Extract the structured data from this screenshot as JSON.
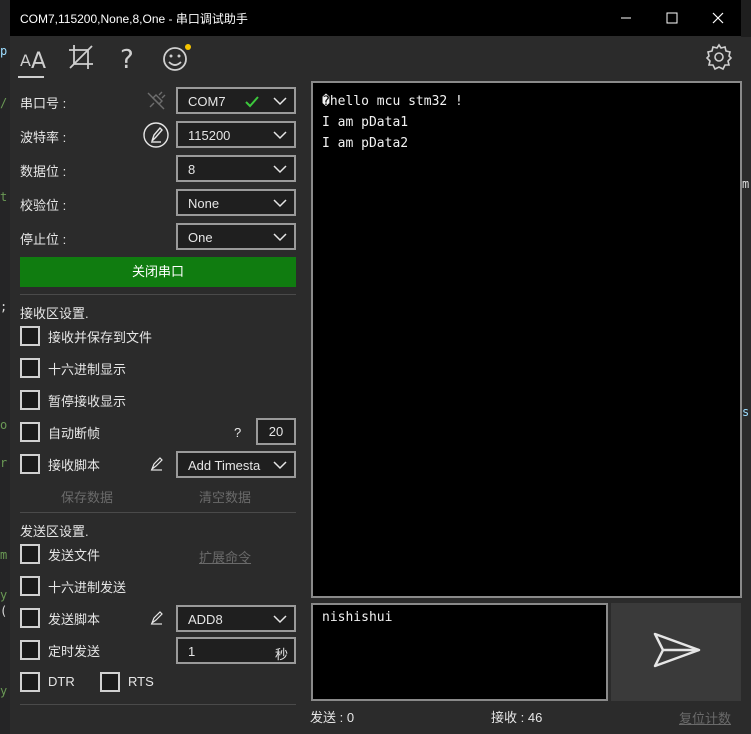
{
  "window": {
    "title": "COM7,115200,None,8,One - 串口调试助手",
    "minimize": "—",
    "maximize": "☐",
    "close": "✕"
  },
  "toolbar": {
    "icons": [
      "font-size-icon",
      "crop-icon",
      "help-icon",
      "emoji-icon",
      "settings-icon"
    ]
  },
  "serial": {
    "port_label": "串口号 :",
    "port_value": "COM7",
    "baud_label": "波特率 :",
    "baud_value": "115200",
    "databits_label": "数据位 :",
    "databits_value": "8",
    "parity_label": "校验位 :",
    "parity_value": "None",
    "stopbits_label": "停止位 :",
    "stopbits_value": "One",
    "close_port_button": "关闭串口"
  },
  "receive_settings": {
    "header": "接收区设置.",
    "save_to_file": "接收并保存到文件",
    "hex_display": "十六进制显示",
    "pause_display": "暂停接收显示",
    "auto_frame": "自动断帧",
    "auto_frame_help": "?",
    "auto_frame_value": "20",
    "receive_script": "接收脚本",
    "receive_script_value": "Add Timesta",
    "save_data": "保存数据",
    "clear_data": "清空数据"
  },
  "send_settings": {
    "header": "发送区设置.",
    "send_file": "发送文件",
    "extend_cmd": "扩展命令",
    "hex_send": "十六进制发送",
    "send_script": "发送脚本",
    "send_script_value": "ADD8",
    "timed_send": "定时发送",
    "timed_value": "1",
    "timed_unit": "秒",
    "dtr": "DTR",
    "rts": "RTS"
  },
  "receive_area": {
    "lines": [
      "�hello mcu stm32 !",
      "I am pData1",
      "I am pData2"
    ]
  },
  "send_area": {
    "value": "nishishui"
  },
  "status": {
    "sent": "发送 : 0",
    "received": "接收 : 46",
    "reset_count": "复位计数"
  },
  "colors": {
    "accent_green": "#107c10",
    "check_green": "#3cc83c"
  }
}
